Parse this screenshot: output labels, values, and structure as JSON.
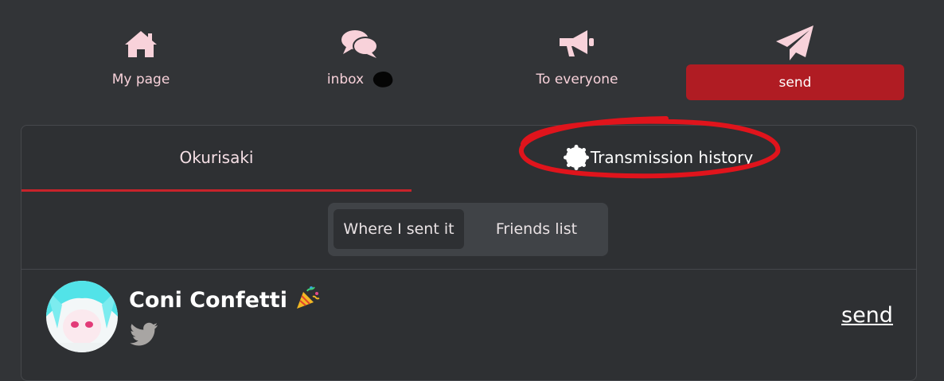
{
  "nav": {
    "my_page": "My page",
    "inbox": "inbox",
    "to_everyone": "To everyone",
    "send": "send"
  },
  "tabs": {
    "okurisaki": "Okurisaki",
    "transmission_history": "Transmission history"
  },
  "segmented": {
    "where_sent": "Where I sent it",
    "friends_list": "Friends list"
  },
  "user": {
    "name": "Coni Confetti",
    "send_link": "send"
  },
  "colors": {
    "background": "#323437",
    "accent_red": "#b01c23",
    "icon_pink": "#f8d2da",
    "annotation_red": "#e0141c"
  },
  "icons": [
    "house-icon",
    "chat-bubbles-icon",
    "megaphone-icon",
    "paper-plane-icon",
    "badge-icon",
    "party-popper-icon",
    "twitter-icon"
  ]
}
